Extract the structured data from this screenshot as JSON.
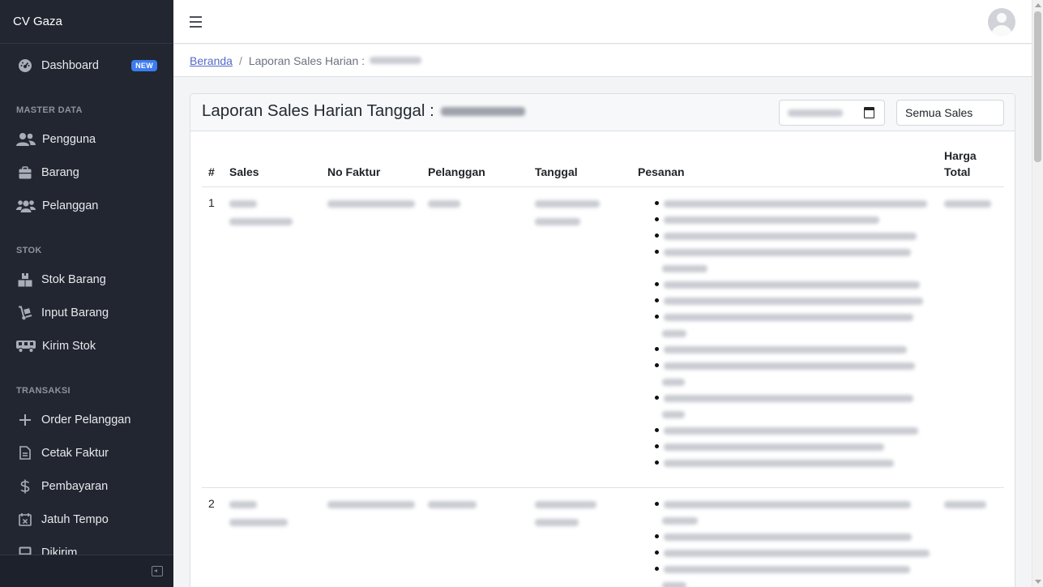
{
  "app": {
    "brand": "CV Gaza"
  },
  "sidebar": {
    "dashboard": {
      "label": "Dashboard",
      "badge": "NEW",
      "icon": "gauge-icon"
    },
    "sections": [
      {
        "title": "MASTER DATA",
        "items": [
          {
            "label": "Pengguna",
            "icon": "users-icon"
          },
          {
            "label": "Barang",
            "icon": "briefcase-icon"
          },
          {
            "label": "Pelanggan",
            "icon": "user-group-icon"
          }
        ]
      },
      {
        "title": "STOK",
        "items": [
          {
            "label": "Stok Barang",
            "icon": "boxes-icon"
          },
          {
            "label": "Input Barang",
            "icon": "dolly-icon"
          },
          {
            "label": "Kirim Stok",
            "icon": "truck-icon"
          }
        ]
      },
      {
        "title": "TRANSAKSI",
        "items": [
          {
            "label": "Order Pelanggan",
            "icon": "plus-icon"
          },
          {
            "label": "Cetak Faktur",
            "icon": "invoice-icon"
          },
          {
            "label": "Pembayaran",
            "icon": "dollar-icon"
          },
          {
            "label": "Jatuh Tempo",
            "icon": "calendar-x-icon"
          },
          {
            "label": "Dikirim",
            "icon": "inbox-icon"
          }
        ]
      }
    ]
  },
  "breadcrumb": {
    "home": "Beranda",
    "separator": "/",
    "current": "Laporan Sales Harian :"
  },
  "card": {
    "title": "Laporan Sales Harian Tanggal :",
    "sales_filter": "Semua Sales"
  },
  "table": {
    "headers": {
      "index": "#",
      "sales": "Sales",
      "no_faktur": "No Faktur",
      "pelanggan": "Pelanggan",
      "tanggal": "Tanggal",
      "pesanan": "Pesanan",
      "harga_total_1": "Harga",
      "harga_total_2": "Total"
    },
    "rows": [
      {
        "index": "1"
      },
      {
        "index": "2"
      }
    ]
  },
  "colors": {
    "sidebar_bg": "#212631",
    "badge_bg": "#3d7bf0",
    "link": "#5469c9"
  }
}
